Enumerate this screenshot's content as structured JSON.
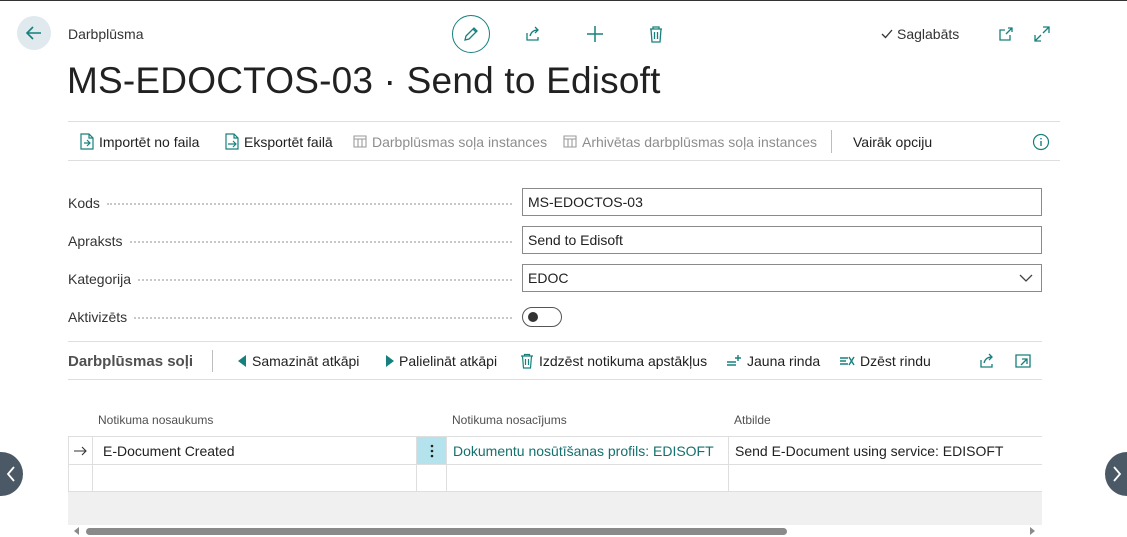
{
  "header": {
    "breadcrumb": "Darbplūsma",
    "saved_status": "Saglabāts",
    "title": "MS-EDOCTOS-03 · Send to Edisoft"
  },
  "actions": [
    {
      "label": "Importēt no faila",
      "icon": "import-file-icon",
      "enabled": true
    },
    {
      "label": "Eksportēt failā",
      "icon": "export-file-icon",
      "enabled": true
    },
    {
      "label": "Darbplūsmas soļa instances",
      "icon": "table-icon",
      "enabled": false
    },
    {
      "label": "Arhivētas darbplūsmas soļa instances",
      "icon": "table-icon",
      "enabled": false
    },
    {
      "label": "Vairāk opciju",
      "icon": "",
      "enabled": true
    }
  ],
  "fields": {
    "code_label": "Kods",
    "code_value": "MS-EDOCTOS-03",
    "description_label": "Apraksts",
    "description_value": "Send to Edisoft",
    "category_label": "Kategorija",
    "category_value": "EDOC",
    "enabled_label": "Aktivizēts",
    "enabled_value": false
  },
  "steps": {
    "title": "Darbplūsmas soļi",
    "actions": [
      {
        "label": "Samazināt atkāpi",
        "icon": "triangle-left-icon"
      },
      {
        "label": "Palielināt atkāpi",
        "icon": "triangle-right-icon"
      },
      {
        "label": "Izdzēst notikuma apstākļus",
        "icon": "trash-icon"
      },
      {
        "label": "Jauna rinda",
        "icon": "new-line-icon"
      },
      {
        "label": "Dzēst rindu",
        "icon": "delete-line-icon"
      }
    ],
    "columns": [
      "Notikuma nosaukums",
      "Notikuma nosacījums",
      "Atbilde"
    ],
    "rows": [
      {
        "event": "E-Document Created",
        "condition": "Dokumentu nosūtīšanas profils: EDISOFT",
        "response": "Send E-Document using service: EDISOFT"
      }
    ]
  },
  "colors": {
    "accent": "#16807d",
    "link": "#14706e",
    "selected_cell": "#b4e3ed",
    "nav": "#4a5965"
  }
}
